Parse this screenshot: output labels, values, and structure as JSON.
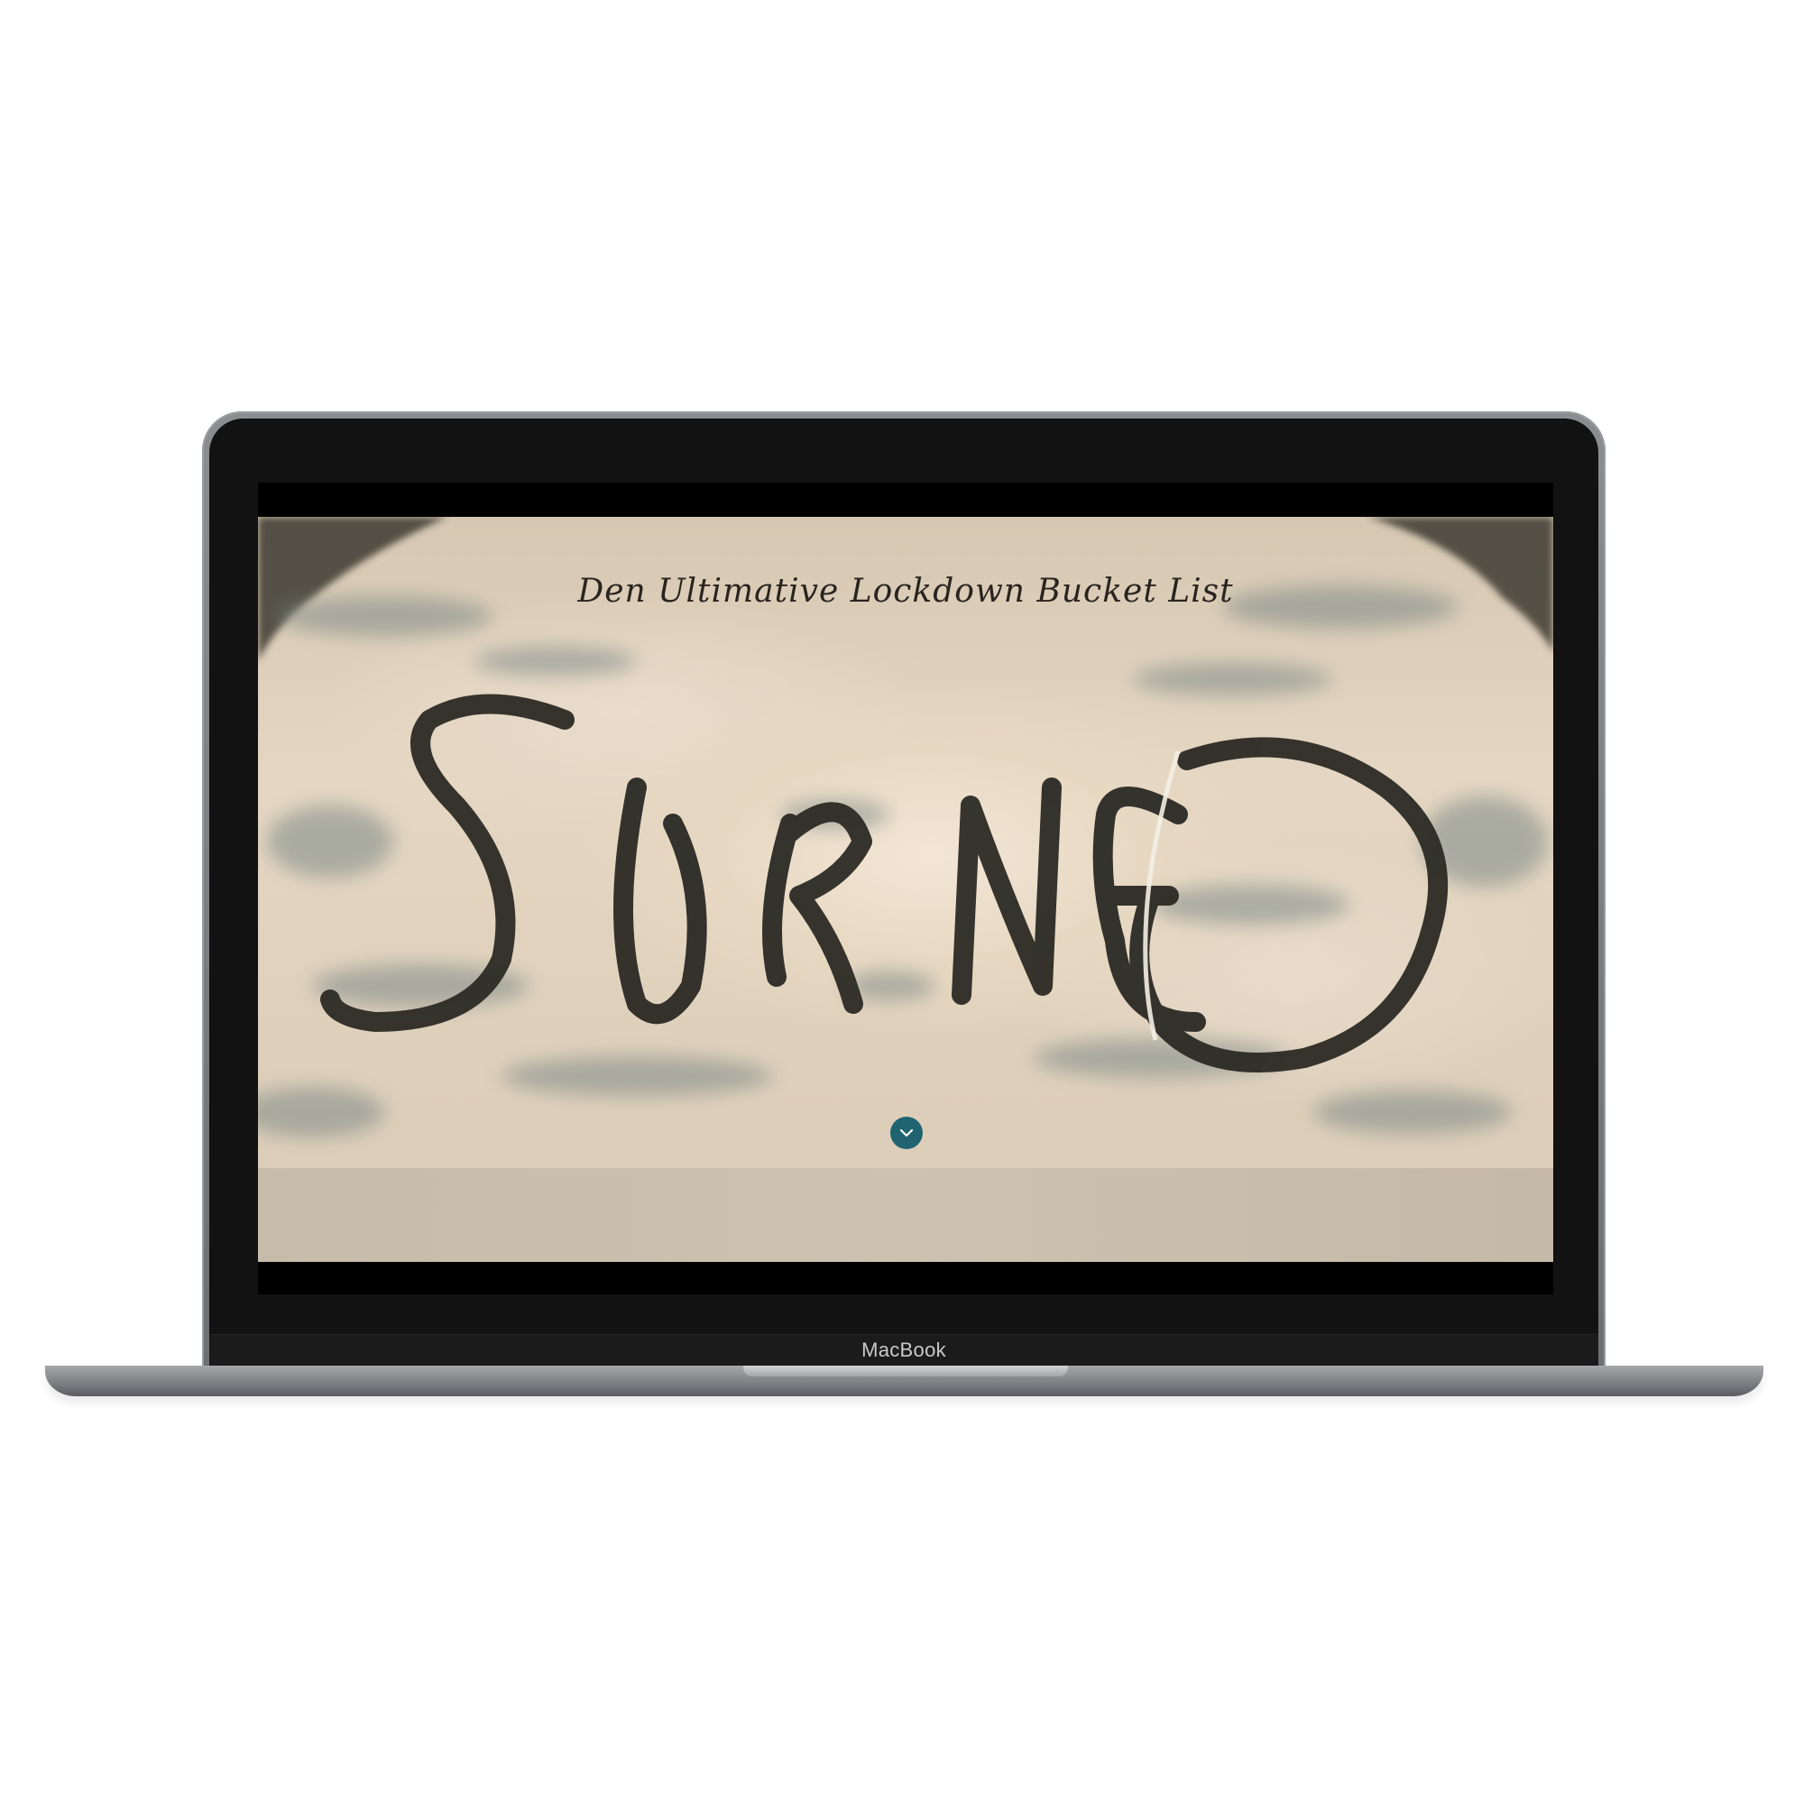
{
  "device": {
    "brand_label": "MacBook"
  },
  "page": {
    "title": "Den Ultimative Lockdown Bucket List",
    "hero_artwork_text": "SURNE",
    "scroll_icon": "chevron-down-icon",
    "accent_color": "#1f6470"
  }
}
